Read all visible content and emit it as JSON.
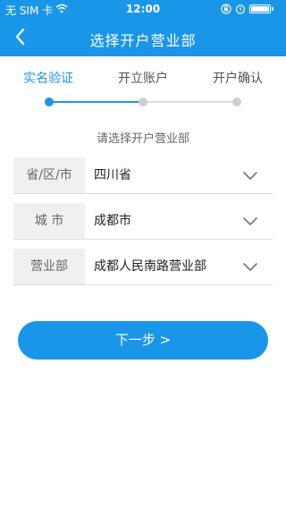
{
  "status_bar": {
    "carrier": "无 SIM 卡",
    "time": "12:00",
    "icons": [
      "wifi-icon",
      "rotation-lock-icon",
      "alarm-icon",
      "battery-icon"
    ]
  },
  "nav": {
    "title": "选择开户营业部",
    "back_icon": "chevron-left-icon"
  },
  "steps": [
    {
      "label": "实名验证",
      "active": true
    },
    {
      "label": "开立账户",
      "active": false
    },
    {
      "label": "开户确认",
      "active": false
    }
  ],
  "subtitle": "请选择开户营业部",
  "fields": [
    {
      "label": "省/区/市",
      "value": "四川省",
      "icon": "chevron-down-icon"
    },
    {
      "label": "城 市",
      "value": "成都市",
      "icon": "chevron-down-icon"
    },
    {
      "label": "营业部",
      "value": "成都人民南路营业部",
      "icon": "chevron-down-icon"
    }
  ],
  "next_button": {
    "label": "下一步 >"
  },
  "colors": {
    "primary": "#1a96e8",
    "inactive": "#cfcfcf",
    "label_bg": "#f0f0f0"
  }
}
